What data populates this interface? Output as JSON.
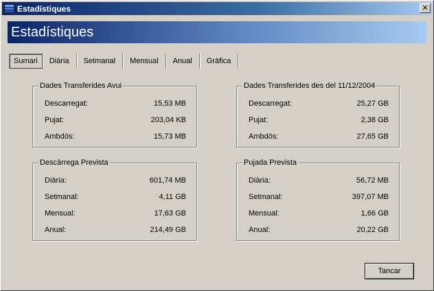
{
  "window": {
    "title": "Estadístiques"
  },
  "banner": {
    "title": "Estadístiques"
  },
  "tabs": [
    {
      "label": "Sumari",
      "active": true
    },
    {
      "label": "Diària"
    },
    {
      "label": "Setmanal"
    },
    {
      "label": "Mensual"
    },
    {
      "label": "Anual"
    },
    {
      "label": "Gràfica"
    }
  ],
  "groups": {
    "today": {
      "title": "Dades Transferides Avui",
      "rows": [
        {
          "label": "Descarregat:",
          "value": "15,53 MB"
        },
        {
          "label": "Pujat:",
          "value": "203,04 KB"
        },
        {
          "label": "Ambdós:",
          "value": "15,73 MB"
        }
      ]
    },
    "since": {
      "title": "Dades Transferides des del 11/12/2004",
      "rows": [
        {
          "label": "Descarregat:",
          "value": "25,27 GB"
        },
        {
          "label": "Pujat:",
          "value": "2,38 GB"
        },
        {
          "label": "Ambdós:",
          "value": "27,65 GB"
        }
      ]
    },
    "download_forecast": {
      "title": "Descàrrega Prevista",
      "rows": [
        {
          "label": "Diària:",
          "value": "601,74 MB"
        },
        {
          "label": "Setmanal:",
          "value": "4,11 GB"
        },
        {
          "label": "Mensual:",
          "value": "17,63 GB"
        },
        {
          "label": "Anual:",
          "value": "214,49 GB"
        }
      ]
    },
    "upload_forecast": {
      "title": "Pujada Prevista",
      "rows": [
        {
          "label": "Diària:",
          "value": "56,72 MB"
        },
        {
          "label": "Setmanal:",
          "value": "397,07 MB"
        },
        {
          "label": "Mensual:",
          "value": "1,66 GB"
        },
        {
          "label": "Anual:",
          "value": "20,22 GB"
        }
      ]
    }
  },
  "buttons": {
    "close_label": "Tancar",
    "titlebar_close": "✕"
  },
  "icons": {
    "app": "stacked-bars-icon",
    "close": "close-icon"
  },
  "colors": {
    "title_gradient_start": "#0a246a",
    "title_gradient_end": "#a6caf0",
    "face": "#d4d0c8"
  }
}
